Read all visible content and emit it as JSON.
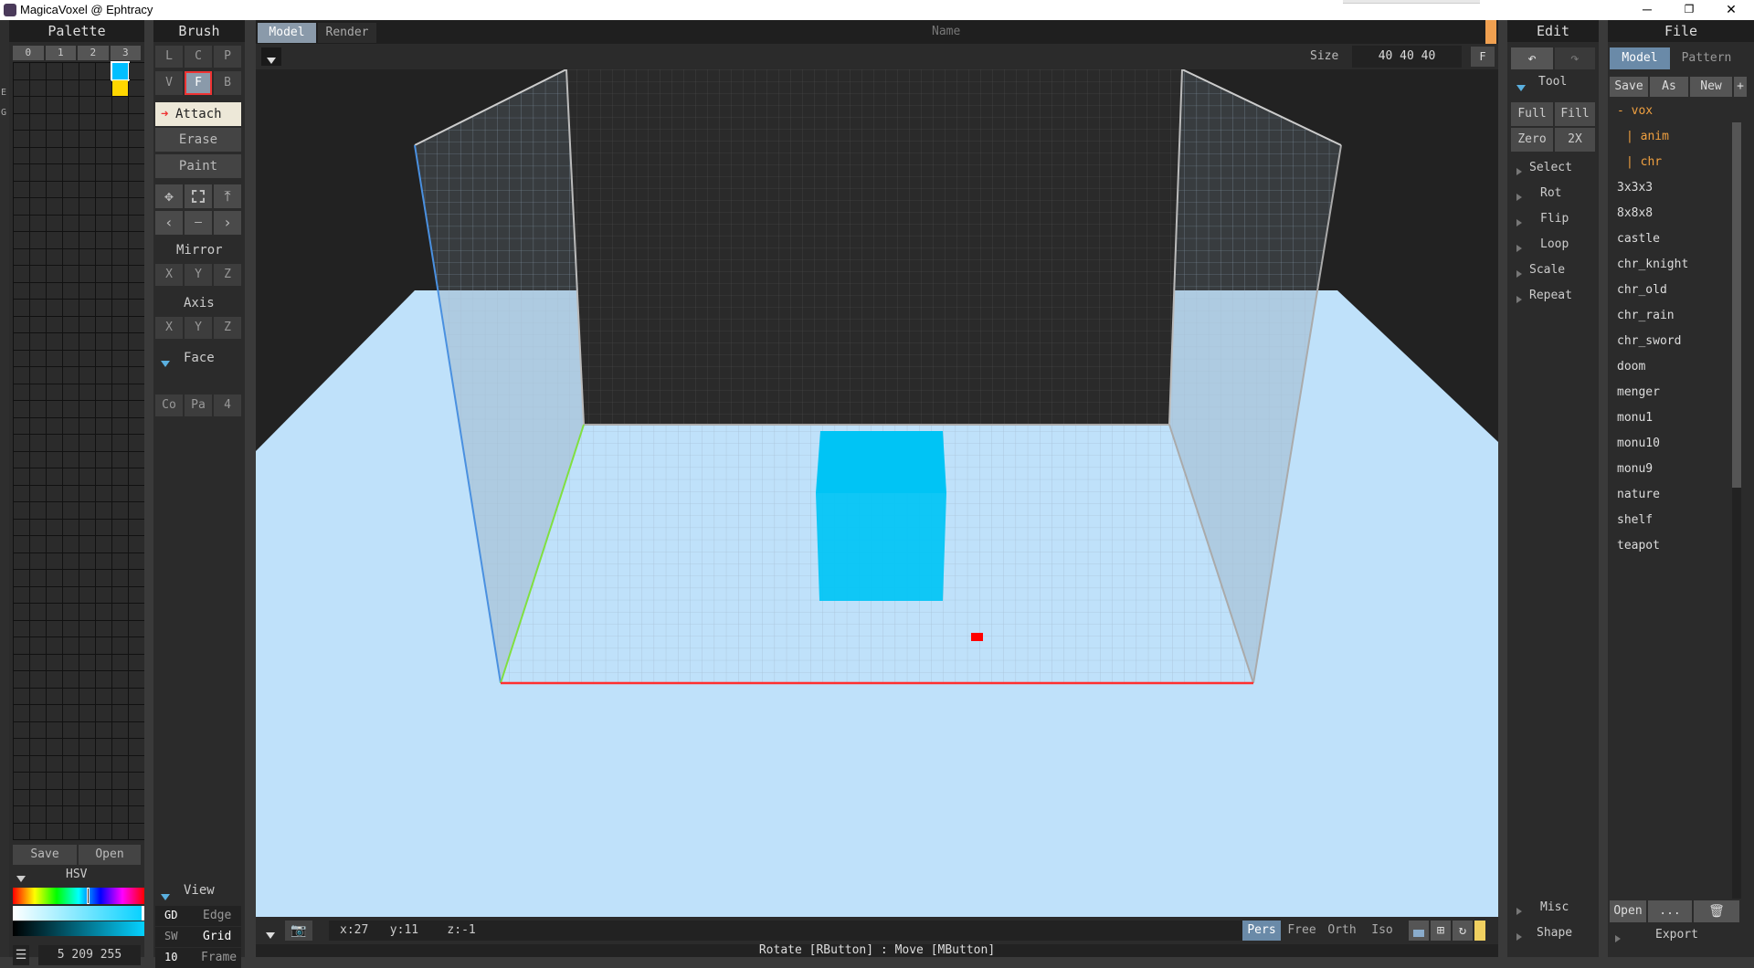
{
  "window": {
    "title": "MagicaVoxel @ Ephtracy",
    "minimize": "─",
    "restore": "❐",
    "close": "✕"
  },
  "palette": {
    "header": "Palette",
    "tabs": [
      "0",
      "1",
      "2",
      "3"
    ],
    "side_tabs": [
      "E",
      "G"
    ],
    "colors": {
      "selected": "#00bfff",
      "second": "#ffd700"
    },
    "save_label": "Save",
    "open_label": "Open",
    "hsv_label": "HSV",
    "color_value": "5 209 255"
  },
  "brush": {
    "header": "Brush",
    "row1": [
      "L",
      "C",
      "P"
    ],
    "row2": [
      "V",
      "F",
      "B"
    ],
    "modes": [
      "Attach",
      "Erase",
      "Paint"
    ],
    "mirror_label": "Mirror",
    "mirror_axes": [
      "X",
      "Y",
      "Z"
    ],
    "axis_label": "Axis",
    "axis_axes": [
      "X",
      "Y",
      "Z"
    ],
    "face_label": "Face",
    "face_buttons": [
      "Co",
      "Pa",
      "4"
    ],
    "view_label": "View",
    "view_rows": [
      [
        "GD",
        "Edge"
      ],
      [
        "SW",
        "Grid"
      ],
      [
        "10",
        "Frame"
      ]
    ]
  },
  "viewport": {
    "tabs": [
      "Model",
      "Render"
    ],
    "name_placeholder": "Name",
    "size_label": "Size",
    "size_value": "40 40 40",
    "size_f": "F",
    "coords": {
      "x": "x:27",
      "y": "y:11",
      "z": "z:-1"
    },
    "proj_modes": [
      "Pers",
      "Free",
      "Orth",
      "Iso"
    ],
    "status": "Rotate [RButton] : Move [MButton]",
    "colors": {
      "floor": "#bfe1fa",
      "voxel": "#00c4f5",
      "marker": "#ff0000",
      "x_axis": "#ff3030",
      "y_axis": "#80e040",
      "z_axis": "#4a90e0"
    }
  },
  "edit": {
    "header": "Edit",
    "tool_label": "Tool",
    "tool_buttons": [
      [
        "Full",
        "Fill"
      ],
      [
        "Zero",
        "2X"
      ]
    ],
    "items": [
      "Select",
      "Rot",
      "Flip",
      "Loop",
      "Scale",
      "Repeat"
    ],
    "bottom_items": [
      "Misc",
      "Shape"
    ]
  },
  "file": {
    "header": "File",
    "tabs": [
      "Model",
      "Pattern"
    ],
    "actions": [
      "Save",
      "As",
      "New",
      "+"
    ],
    "folder": "- vox",
    "subfolders": [
      "| anim",
      "| chr"
    ],
    "files": [
      "3x3x3",
      "8x8x8",
      "castle",
      "chr_knight",
      "chr_old",
      "chr_rain",
      "chr_sword",
      "doom",
      "menger",
      "monu1",
      "monu10",
      "monu9",
      "nature",
      "shelf",
      "teapot"
    ],
    "open_label": "Open",
    "dots_label": "...",
    "export_label": "Export"
  }
}
